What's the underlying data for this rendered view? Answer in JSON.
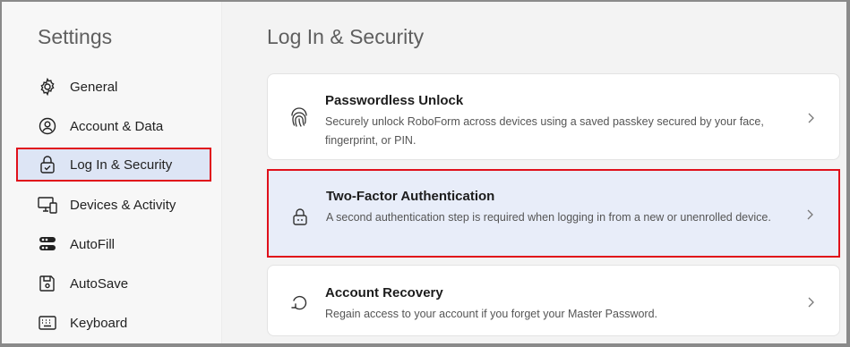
{
  "sidebar": {
    "title": "Settings",
    "items": [
      {
        "label": "General",
        "icon": "gear-icon"
      },
      {
        "label": "Account & Data",
        "icon": "user-circle-icon"
      },
      {
        "label": "Log In & Security",
        "icon": "lock-shield-icon",
        "active": true
      },
      {
        "label": "Devices & Activity",
        "icon": "devices-icon"
      },
      {
        "label": "AutoFill",
        "icon": "autofill-icon"
      },
      {
        "label": "AutoSave",
        "icon": "save-icon"
      },
      {
        "label": "Keyboard",
        "icon": "keyboard-icon"
      }
    ]
  },
  "main": {
    "title": "Log In & Security",
    "cards": [
      {
        "title": "Passwordless Unlock",
        "description": "Securely unlock RoboForm across devices using a saved passkey secured by your face, fingerprint, or PIN.",
        "icon": "fingerprint-icon"
      },
      {
        "title": "Two-Factor Authentication",
        "description": "A second authentication step is required when logging in from a new or unenrolled device.",
        "icon": "padlock-icon",
        "highlighted": true
      },
      {
        "title": "Account Recovery",
        "description": "Regain access to your account if you forget your Master Password.",
        "icon": "recovery-icon"
      }
    ]
  },
  "colors": {
    "highlight_border": "#e0101a",
    "active_bg": "#dde5f5",
    "card_hl_bg": "#e8edf9"
  }
}
